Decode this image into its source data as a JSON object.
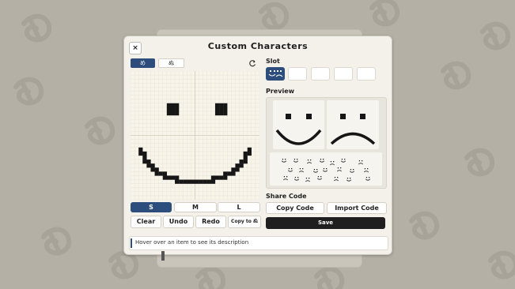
{
  "dialog": {
    "title": "Custom Characters",
    "close_label": "×"
  },
  "font_tabs": [
    {
      "label": "め",
      "active": true
    },
    {
      "label": "ぬ",
      "active": false
    }
  ],
  "editor": {
    "grid_columns": 32,
    "grid_rows": 32,
    "pixels": [
      "................................",
      "................................",
      "................................",
      "................................",
      "................................",
      "................................",
      "................................",
      "................................",
      ".........###.........###........",
      ".........###.........###........",
      ".........###.........###........",
      "................................",
      "................................",
      "................................",
      "................................",
      "................................",
      "................................",
      "................................",
      "................................",
      "..#..........................#..",
      "..##........................##..",
      "...#........................#...",
      "...##......................##...",
      "....##....................##....",
      ".....##..................##.....",
      "......###..............###......",
      "........####........####........",
      "...........##########...........",
      "................................",
      "................................",
      "................................",
      "................................"
    ],
    "pixel_color": "#161616",
    "grid_bg": "#f7f4e9",
    "grid_line": "#e6e1d2",
    "grid_major": "#d0cab8"
  },
  "size_buttons": [
    {
      "label": "S",
      "active": true
    },
    {
      "label": "M",
      "active": false
    },
    {
      "label": "L",
      "active": false
    }
  ],
  "actions": {
    "clear": "Clear",
    "undo": "Undo",
    "redo": "Redo",
    "copy_to": "Copy to ぬ"
  },
  "slot": {
    "label": "Slot",
    "count": 5,
    "selected": 0
  },
  "preview": {
    "label": "Preview"
  },
  "share": {
    "label": "Share Code",
    "copy_code": "Copy Code",
    "import_code": "Import Code"
  },
  "save_label": "Save",
  "status_text": "Hover over an item to see its description",
  "colors": {
    "accent": "#2d4d7c",
    "save_bg": "#1f1f1f",
    "backdrop": "#b4b0a6"
  }
}
